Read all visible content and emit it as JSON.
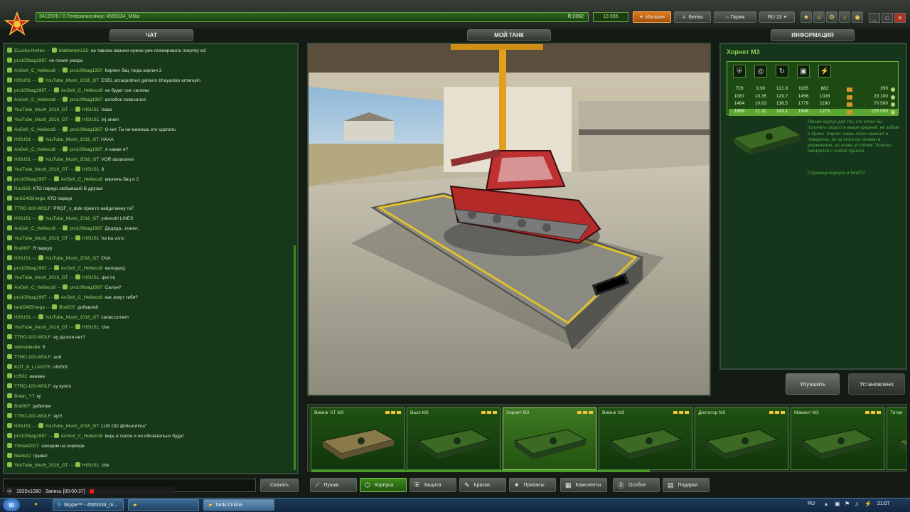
{
  "topbar": {
    "xp_text": "3412978 / 0  Генералиссимус 4565334_Millia",
    "rank_progress": "R:2062",
    "crystals": "13 555",
    "shop_label": "Магазин",
    "battles_label": "Битвы",
    "garage_label": "Гараж",
    "server_label": "RU 13"
  },
  "headers": {
    "chat": "ЧАТ",
    "my_tank": "МОЙ ТАНК",
    "info": "ИНФОРМАЦИЯ"
  },
  "chat": {
    "send_label": "Сказать",
    "lines": [
      {
        "user": "ELucho Ne4es",
        "to": "blakberten135",
        "text": "на тавоем авании нужно уже планировать покупку м2"
      },
      {
        "user": "pro100bag1997",
        "to": "",
        "text": "не понял умора"
      },
      {
        "user": "AnGeII_C_He6eco8",
        "to": "pro100bag1997",
        "text": "Кирпич бац тогда кирпич 2"
      },
      {
        "user": "HISUS1",
        "to": "YouTube_Mush_2016_GT",
        "text": "ESEL arzaqurdneri galisern bhayastan amarayin"
      },
      {
        "user": "pro100bag1997",
        "to": "AnGeII_C_He6eco8",
        "text": "не будет сне салоны"
      },
      {
        "user": "AnGeII_C_He6eco8",
        "to": "pro100bag1997",
        "text": "колобок повесился"
      },
      {
        "user": "YouTube_Mush_2016_GT",
        "to": "HISUS1",
        "text": "haaa"
      },
      {
        "user": "YouTube_Mush_2016_GT",
        "to": "HISUS1",
        "text": "inj anem"
      },
      {
        "user": "AnGeII_C_He6eco8",
        "to": "pro100bag1997",
        "text": "О нет Ты не можешь это сделать"
      },
      {
        "user": "HISUS1",
        "to": "YouTube_Mush_2016_GT",
        "text": "HAAA"
      },
      {
        "user": "AnGeII_C_He6eco8",
        "to": "pro100bag1997",
        "text": "А какже я?"
      },
      {
        "user": "HISUS1",
        "to": "YouTube_Mush_2016_GT",
        "text": "VOR dasaranes"
      },
      {
        "user": "YouTube_Mush_2016_GT",
        "to": "HISUS1",
        "text": "8"
      },
      {
        "user": "pro100bag1997",
        "to": "AnGeII_C_He6eco8",
        "text": "кирпичь бац и 2"
      },
      {
        "user": "Rou563",
        "to": "",
        "text": "КТО паркур любывший В друзья"
      },
      {
        "user": "tank5495mega",
        "to": "",
        "text": "КТО паркур"
      },
      {
        "user": "TTRO-100-WOLF",
        "to": "",
        "text": "PROF_v_dule прив го найди мину го7"
      },
      {
        "user": "HISUS1",
        "to": "YouTube_Mush_2016_GT",
        "text": "ynkeruhl LINES"
      },
      {
        "user": "AnGeII_C_He6eco8",
        "to": "pro100bag1997",
        "text": "Дядяда...понял.."
      },
      {
        "user": "YouTube_Mush_2016_GT",
        "to": "HISUS1",
        "text": "ha ba vonc"
      },
      {
        "user": "Bod007",
        "to": "",
        "text": "Я паркур"
      },
      {
        "user": "HISUS1",
        "to": "YouTube_Mush_2016_GT",
        "text": "OVA"
      },
      {
        "user": "pro100bag1997",
        "to": "AnGeII_C_He6eco8",
        "text": "молодец)"
      },
      {
        "user": "YouTube_Mush_2016_GT",
        "to": "HISUS1",
        "text": "qez inj"
      },
      {
        "user": "AnGeII_C_He6eco8",
        "to": "pro100bag1997",
        "text": "Салон?"
      },
      {
        "user": "pro100bag1997",
        "to": "AnGeII_C_He6eco8",
        "text": "как зовут тебя?"
      },
      {
        "user": "tank5495mega",
        "to": "Bod007",
        "text": "добавляй"
      },
      {
        "user": "HISUS1",
        "to": "YouTube_Mush_2016_GT",
        "text": "canaccumem"
      },
      {
        "user": "YouTube_Mush_2016_GT",
        "to": "HISUS1",
        "text": "che"
      },
      {
        "user": "TTRO-100-WOLF",
        "to": "",
        "text": "ну да или нет?"
      },
      {
        "user": "skimublas84",
        "to": "",
        "text": "5"
      },
      {
        "user": "TTRO-100-WOLF",
        "to": "",
        "text": "алё"
      },
      {
        "user": "KOT_B_LLIAПTE",
        "to": "",
        "text": "лбгбгб"
      },
      {
        "user": "icr502",
        "to": "",
        "text": "аааааа"
      },
      {
        "user": "TTRO-100-WOLF",
        "to": "",
        "text": "ку куппп"
      },
      {
        "user": "Bolan_YT",
        "to": "",
        "text": "ку"
      },
      {
        "user": "Bod007",
        "to": "",
        "text": "дебилии"
      },
      {
        "user": "TTRO-100-WOLF",
        "to": "",
        "text": "яу!!!"
      },
      {
        "user": "HISUS1",
        "to": "YouTube_Mush_2016_GT",
        "text": "LUS OO @nkuruhina\""
      },
      {
        "user": "pro100bag1997",
        "to": "AnGeII_C_He6eco8",
        "text": "верь в салон и он обязательно будет"
      },
      {
        "user": "Y9vlad2007",
        "to": "",
        "text": "заходим на сервера"
      },
      {
        "user": "Marik22",
        "to": "",
        "text": "привет"
      },
      {
        "user": "YouTube_Mush_2016_GT",
        "to": "HISUS1",
        "text": "che"
      }
    ]
  },
  "info": {
    "title": "Хорнет М3",
    "stat_icons": [
      "shield-icon",
      "speed-icon",
      "turn-icon",
      "weight-icon",
      "power-icon"
    ],
    "stats": [
      {
        "values": [
          "729",
          "9.90",
          "121.8",
          "1165",
          "882"
        ],
        "cost": "350",
        "selected": false
      },
      {
        "values": [
          "1087",
          "10.35",
          "129.7",
          "1456",
          "1028"
        ],
        "cost": "23 100",
        "selected": false
      },
      {
        "values": [
          "1484",
          "10.83",
          "138.5",
          "1779",
          "1190"
        ],
        "cost": "70 500",
        "selected": false
      },
      {
        "values": [
          "1689",
          "11.11",
          "143.1",
          "1946",
          "1273"
        ],
        "cost": "225 050",
        "selected": true
      }
    ],
    "description": "Лёгкий корпус для тех, кто хотел бы получить скорость выше средней, не забыв о броне. Хорнет очень легко заносит в поворотах, из-за этого он сложен в управлении, но очень устойчив. Хорошо смотрится с любой пушкой.",
    "wiki_link": "Страница корпуса в WikiTO",
    "upgrade_label": "Улучшить",
    "installed_label": "Установлено"
  },
  "garage": {
    "items": [
      {
        "name": "Викинг ХТ М3",
        "camo": "desert",
        "selected": false
      },
      {
        "name": "Васп М3",
        "camo": "green",
        "selected": false
      },
      {
        "name": "Хорнет М3",
        "camo": "green",
        "selected": true
      },
      {
        "name": "Викинг М3",
        "camo": "green",
        "selected": false
      },
      {
        "name": "Диктатор М3",
        "camo": "green",
        "selected": false
      },
      {
        "name": "Мамонт М3",
        "camo": "green",
        "selected": false
      },
      {
        "name": "Титан",
        "camo": "green",
        "selected": false
      }
    ]
  },
  "tabs": [
    {
      "label": "Пушки",
      "icon": "gun-icon",
      "selected": false
    },
    {
      "label": "Корпуса",
      "icon": "hull-icon",
      "selected": true
    },
    {
      "label": "Защита",
      "icon": "shield-icon",
      "selected": false
    },
    {
      "label": "Краски",
      "icon": "brush-icon",
      "selected": false
    },
    {
      "label": "Припасы",
      "icon": "wrench-icon",
      "selected": false
    },
    {
      "label": "Комплекты",
      "icon": "kit-icon",
      "selected": false
    },
    {
      "label": "Особое",
      "icon": "special-icon",
      "selected": false
    },
    {
      "label": "Подарки",
      "icon": "gift-icon",
      "selected": false
    }
  ],
  "recorder": {
    "resolution": "1920x1080",
    "status": "Запись [00:00:37]"
  },
  "taskbar": {
    "tasks": [
      "Skype™ - 4565334_m...",
      "",
      "Tanki Online"
    ],
    "language": "RU",
    "clock": "21:07"
  }
}
